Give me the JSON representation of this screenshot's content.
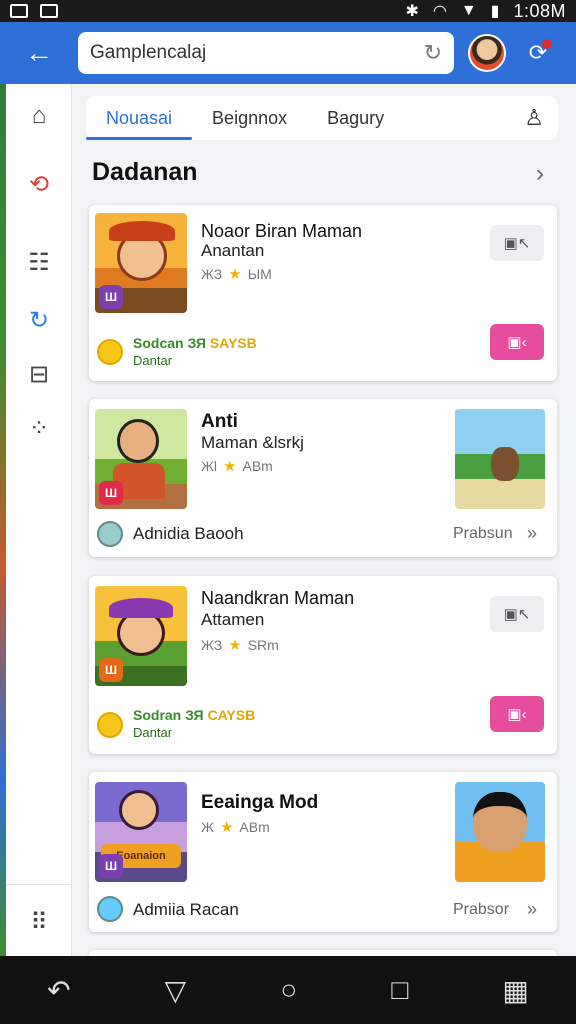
{
  "status_bar": {
    "time": "1:08M"
  },
  "header": {
    "search_value": "Gamplencalaj",
    "search_placeholder": "Gamplencalaj"
  },
  "tabs": [
    {
      "label": "Nouasai"
    },
    {
      "label": "Beignnox"
    },
    {
      "label": "Bagury"
    }
  ],
  "section": {
    "title": "Dadanan"
  },
  "cards": [
    {
      "title": "Noaor Biran Maman",
      "subtitle": "Anantan",
      "rating_prefix": "ЖЗ",
      "rating_suffix": "ЫМ",
      "promo_main": "Sodcan ЗЯ",
      "promo_highlight": "SAYSB",
      "promo_sub": "Dantar",
      "badge": "Ш"
    },
    {
      "title": "Anti",
      "subtitle": "Maman &lsrkj",
      "rating_prefix": "Жl",
      "rating_suffix": "ABm",
      "footer_label": "Adnidia Baooh",
      "footer_right": "Prabsun",
      "badge": "Ш"
    },
    {
      "title": "Naandkran Maman",
      "subtitle": "Attamen",
      "rating_prefix": "ЖЗ",
      "rating_suffix": "SRm",
      "promo_main": "Sodran ЗЯ",
      "promo_highlight": "CAYSB",
      "promo_sub": "Dantar",
      "badge": "Ш"
    },
    {
      "title": "Eeainga Mod",
      "rating_prefix": "Ж",
      "rating_suffix": "ABm",
      "footer_label": "Admiia Racan",
      "footer_right": "Prabsor",
      "badge": "Ш",
      "thumb_text": "Eoanaion"
    }
  ]
}
